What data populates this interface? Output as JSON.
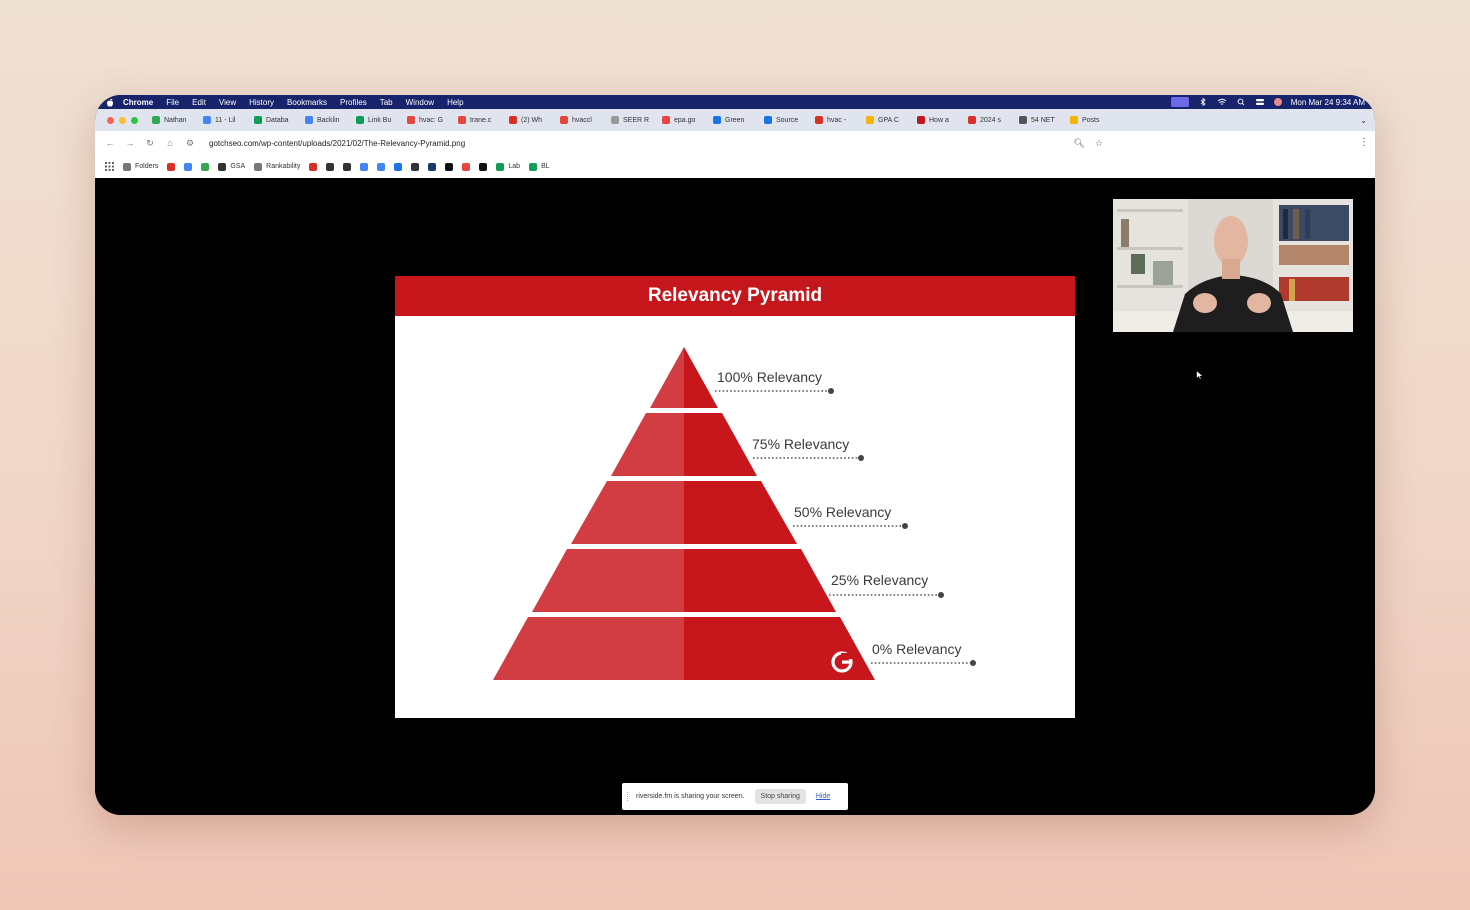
{
  "menubar": {
    "items": [
      "Chrome",
      "File",
      "Edit",
      "View",
      "History",
      "Bookmarks",
      "Profiles",
      "Tab",
      "Window",
      "Help"
    ],
    "datetime": "Mon Mar 24  9:34 AM"
  },
  "tabs": [
    {
      "label": "Nathan",
      "color": "#34a853"
    },
    {
      "label": "11 - Lil",
      "color": "#4285f4"
    },
    {
      "label": "Databa",
      "color": "#0f9d58"
    },
    {
      "label": "Backlin",
      "color": "#4285f4"
    },
    {
      "label": "Link Bu",
      "color": "#0f9d58"
    },
    {
      "label": "hvac: G",
      "color": "#e8453c"
    },
    {
      "label": "trane.c",
      "color": "#e8453c"
    },
    {
      "label": "(2) Wh",
      "color": "#d93025"
    },
    {
      "label": "hvaccl",
      "color": "#e8453c"
    },
    {
      "label": "SEER R",
      "color": "#999999"
    },
    {
      "label": "epa.go",
      "color": "#e8453c"
    },
    {
      "label": "Green",
      "color": "#1a73e8"
    },
    {
      "label": "Source",
      "color": "#1a73e8"
    },
    {
      "label": "hvac -",
      "color": "#d93025"
    },
    {
      "label": "GPA C",
      "color": "#f4b400"
    },
    {
      "label": "How a",
      "color": "#c5161b"
    },
    {
      "label": "2024 s",
      "color": "#d93025"
    },
    {
      "label": "54 NET",
      "color": "#555555"
    },
    {
      "label": "Posts",
      "color": "#f4b400"
    }
  ],
  "address": {
    "url": "gotchseo.com/wp-content/uploads/2021/02/The-Relevancy-Pyramid.png"
  },
  "bookmarks": [
    {
      "label": "Folders",
      "color": "#777777"
    },
    {
      "label": "",
      "color": "#d93025"
    },
    {
      "label": "",
      "color": "#4285f4"
    },
    {
      "label": "",
      "color": "#34a853"
    },
    {
      "label": "GSA",
      "color": "#333333"
    },
    {
      "label": "Rankability",
      "color": "#777777"
    },
    {
      "label": "",
      "color": "#d93025"
    },
    {
      "label": "",
      "color": "#333333"
    },
    {
      "label": "",
      "color": "#333333"
    },
    {
      "label": "",
      "color": "#4285f4"
    },
    {
      "label": "",
      "color": "#4285f4"
    },
    {
      "label": "",
      "color": "#1a73e8"
    },
    {
      "label": "",
      "color": "#333333"
    },
    {
      "label": "",
      "color": "#1a3a6b"
    },
    {
      "label": "",
      "color": "#111111"
    },
    {
      "label": "",
      "color": "#e8453c"
    },
    {
      "label": "",
      "color": "#111111"
    },
    {
      "label": "Lab",
      "color": "#0f9d58"
    },
    {
      "label": "BL",
      "color": "#0f9d58"
    }
  ],
  "slide": {
    "title": "Relevancy Pyramid",
    "levels": [
      "100% Relevancy",
      "75% Relevancy",
      "50% Relevancy",
      "25% Relevancy",
      "0% Relevancy"
    ],
    "logo_letter": "G",
    "colors": {
      "header": "#c5161b",
      "left": "#d13d42",
      "right": "#c8161d"
    }
  },
  "share": {
    "message": "riverside.fm is sharing your screen.",
    "stop_label": "Stop sharing",
    "hide_label": "Hide"
  }
}
